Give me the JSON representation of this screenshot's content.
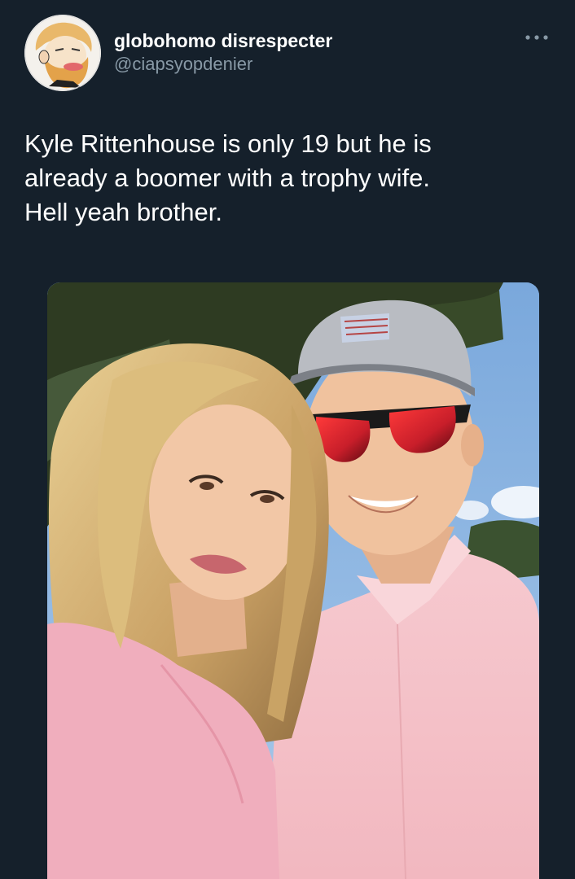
{
  "tweet": {
    "author": {
      "display_name": "globohomo disrespecter",
      "handle": "@ciapsyopdenier",
      "avatar_icon": "bearded-cartoon-avatar-icon"
    },
    "more_icon": "more-horizontal-icon",
    "text": "Kyle Rittenhouse is only 19 but he is\nalready a boomer with a trophy wife.\nHell yeah brother.",
    "media": {
      "type": "photo",
      "accessible_label": "Selfie of a young man in a gray cap, red mirrored sunglasses and pink shirt next to a blonde woman in pink, trees and blue sky behind"
    }
  },
  "colors": {
    "background": "#15202b",
    "primary_text": "#ffffff",
    "secondary_text": "#8899a6"
  }
}
